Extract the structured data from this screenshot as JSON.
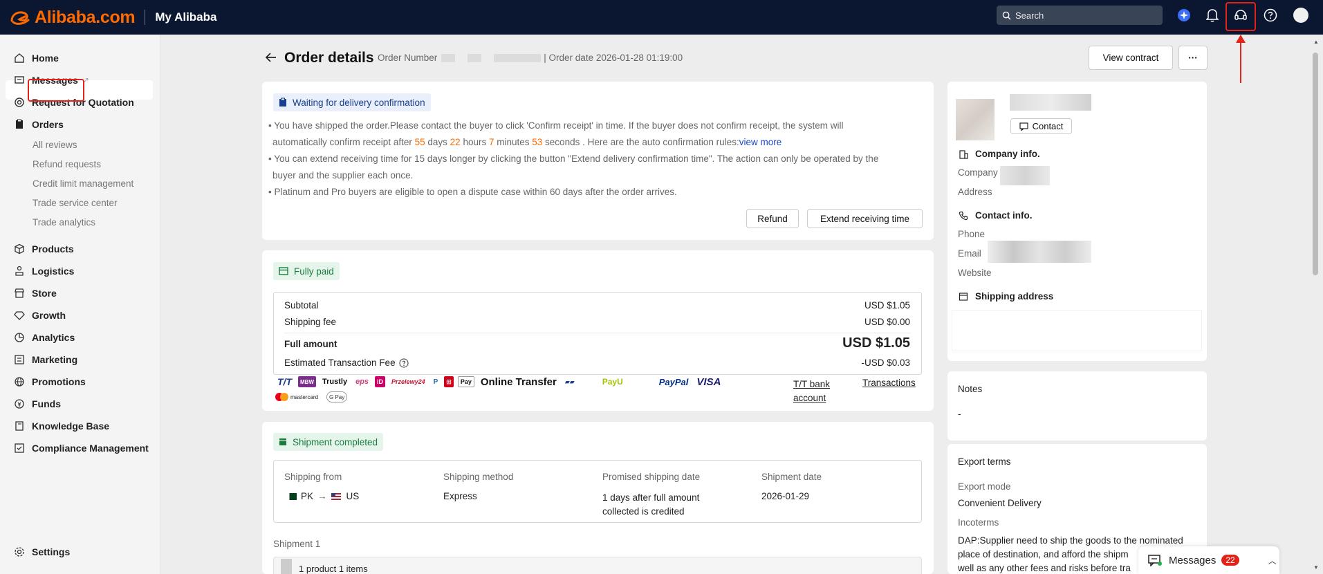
{
  "header": {
    "logo_text": "Alibaba.com",
    "section_title": "My Alibaba",
    "search_placeholder": "Search"
  },
  "sidebar": {
    "items": [
      {
        "label": "Home",
        "icon": "home-icon"
      },
      {
        "label": "Messages",
        "icon": "message-icon"
      },
      {
        "label": "Request for Quotation",
        "icon": "target-icon"
      },
      {
        "label": "Orders",
        "icon": "clipboard-icon"
      },
      {
        "label": "Products",
        "icon": "box-icon"
      },
      {
        "label": "Logistics",
        "icon": "logistics-icon"
      },
      {
        "label": "Store",
        "icon": "store-icon"
      },
      {
        "label": "Growth",
        "icon": "diamond-icon"
      },
      {
        "label": "Analytics",
        "icon": "analytics-icon"
      },
      {
        "label": "Marketing",
        "icon": "marketing-icon"
      },
      {
        "label": "Promotions",
        "icon": "globe-icon"
      },
      {
        "label": "Funds",
        "icon": "funds-icon"
      },
      {
        "label": "Knowledge Base",
        "icon": "book-icon"
      },
      {
        "label": "Compliance Management",
        "icon": "compliance-icon"
      }
    ],
    "order_subitems": [
      "All reviews",
      "Refund requests",
      "Credit limit management",
      "Trade service center",
      "Trade analytics"
    ],
    "settings_label": "Settings"
  },
  "page": {
    "title": "Order details",
    "order_number_label": "Order Number",
    "order_date": "| Order date 2026-01-28 01:19:00",
    "view_contract": "View contract",
    "more": "···"
  },
  "status_card": {
    "tag": "Waiting for delivery confirmation",
    "line1a": "You have shipped the order.Please contact the buyer to click 'Confirm receipt' in time. If the buyer does not confirm receipt, the system will",
    "line1b_pre": "automatically confirm receipt after ",
    "days": "55",
    "days_label": " days ",
    "hours": "22",
    "hours_label": " hours ",
    "minutes": "7",
    "minutes_label": " minutes ",
    "seconds": "53",
    "seconds_label": " seconds . Here are the auto confirmation rules:",
    "view_more": "view more",
    "line2a": "You can extend receiving time for 15 days longer by clicking the button \"Extend delivery confirmation time\". The action can only be operated by the",
    "line2b": "buyer and the supplier each once.",
    "line3": "Platinum and Pro buyers are eligible to open a dispute case within 60 days after the order arrives.",
    "refund": "Refund",
    "extend": "Extend receiving time"
  },
  "payment_card": {
    "tag": "Fully paid",
    "subtotal_label": "Subtotal",
    "subtotal": "USD $1.05",
    "shipping_label": "Shipping fee",
    "shipping": "USD $0.00",
    "full_label": "Full amount",
    "full": "USD $1.05",
    "fee_label": "Estimated Transaction Fee",
    "fee": "-USD $0.03",
    "methods": [
      "T/T",
      "Trustly",
      "Przelewy24",
      "Online Transfer",
      "PayU",
      "PayPal",
      "VISA",
      "mastercard",
      "G Pay"
    ],
    "tt_link_1": "T/T bank",
    "tt_link_2": "account",
    "transactions": "Transactions"
  },
  "shipment_card": {
    "tag": "Shipment completed",
    "headers": [
      "Shipping from",
      "Shipping method",
      "Promised shipping date",
      "Shipment date"
    ],
    "from": "PK",
    "to": "US",
    "method": "Express",
    "promised_1": "1 days after full amount",
    "promised_2": "collected is credited",
    "date": "2026-01-29",
    "shipment_label": "Shipment 1",
    "items_label": "1 product 1 items"
  },
  "right_panel": {
    "contact": "Contact",
    "company_info": "Company info.",
    "company": "Company",
    "address": "Address",
    "contact_info": "Contact info.",
    "phone": "Phone",
    "email": "Email",
    "website": "Website",
    "shipping_address": "Shipping address",
    "notes_title": "Notes",
    "notes_value": "-",
    "export_title": "Export terms",
    "export_mode_label": "Export mode",
    "export_mode": "Convenient Delivery",
    "incoterms_label": "Incoterms",
    "incoterms_1": "DAP:Supplier need to ship the goods to the nominated",
    "incoterms_2": "place of destination, and afford the shipm",
    "incoterms_3": "well as any other fees and risks before tra"
  },
  "messages_widget": {
    "label": "Messages",
    "count": "22"
  },
  "colors": {
    "accent_orange": "#ff6a00",
    "header_bg": "#0b1730",
    "highlight_red": "#e2231a",
    "link_blue": "#1a47c7"
  }
}
